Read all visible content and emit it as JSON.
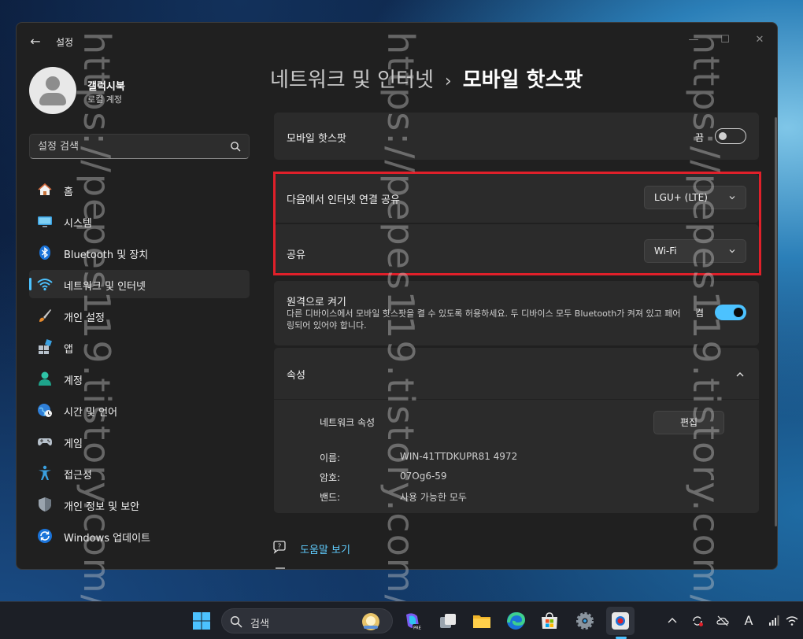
{
  "window": {
    "title": "설정",
    "back_glyph": "←",
    "min_glyph": "—",
    "max_glyph": "☐",
    "close_glyph": "✕"
  },
  "profile": {
    "name": "갤럭시북",
    "account_type": "로컬 계정"
  },
  "search": {
    "placeholder": "설정 검색"
  },
  "sidebar": {
    "items": [
      {
        "label": "홈",
        "icon": "home-icon"
      },
      {
        "label": "시스템",
        "icon": "system-icon"
      },
      {
        "label": "Bluetooth 및 장치",
        "icon": "bluetooth-icon"
      },
      {
        "label": "네트워크 및 인터넷",
        "icon": "wifi-icon",
        "active": true
      },
      {
        "label": "개인 설정",
        "icon": "brush-icon"
      },
      {
        "label": "앱",
        "icon": "apps-icon"
      },
      {
        "label": "계정",
        "icon": "account-icon"
      },
      {
        "label": "시간 및 언어",
        "icon": "globe-clock-icon"
      },
      {
        "label": "게임",
        "icon": "gamepad-icon"
      },
      {
        "label": "접근성",
        "icon": "accessibility-icon"
      },
      {
        "label": "개인 정보 및 보안",
        "icon": "shield-icon"
      },
      {
        "label": "Windows 업데이트",
        "icon": "update-icon"
      }
    ]
  },
  "breadcrumb": {
    "parent": "네트워크 및 인터넷",
    "separator": "›",
    "current": "모바일 핫스팟"
  },
  "hotspot": {
    "label": "모바일 핫스팟",
    "state_text": "끔",
    "enabled": false
  },
  "share_from": {
    "label": "다음에서 인터넷 연결 공유",
    "value": "LGU+ (LTE)"
  },
  "share_over": {
    "label": "공유",
    "value": "Wi-Fi"
  },
  "remote": {
    "label": "원격으로 켜기",
    "description": "다른 디바이스에서 모바일 핫스팟을 켤 수 있도록 허용하세요. 두 디바이스 모두 Bluetooth가 켜져 있고 페어링되어 있어야 합니다.",
    "state_text": "켬",
    "enabled": true
  },
  "properties": {
    "header": "속성",
    "network_label": "네트워크 속성",
    "edit_label": "편집",
    "rows": [
      {
        "label": "이름:",
        "value": "WIN-41TTDKUPR81 4972"
      },
      {
        "label": "암호:",
        "value": "07Og6-59"
      },
      {
        "label": "밴드:",
        "value": "사용 가능한 모두"
      }
    ]
  },
  "help": {
    "label": "도움말 보기"
  },
  "watermark": "https://pepes119.tistory.com/",
  "taskbar": {
    "search_label": "검색"
  },
  "tray": {
    "ime": "A"
  },
  "colors": {
    "accent": "#4cc2ff",
    "highlight_box": "#e0202a",
    "window_bg": "#202020",
    "card_bg": "#2b2b2b"
  }
}
